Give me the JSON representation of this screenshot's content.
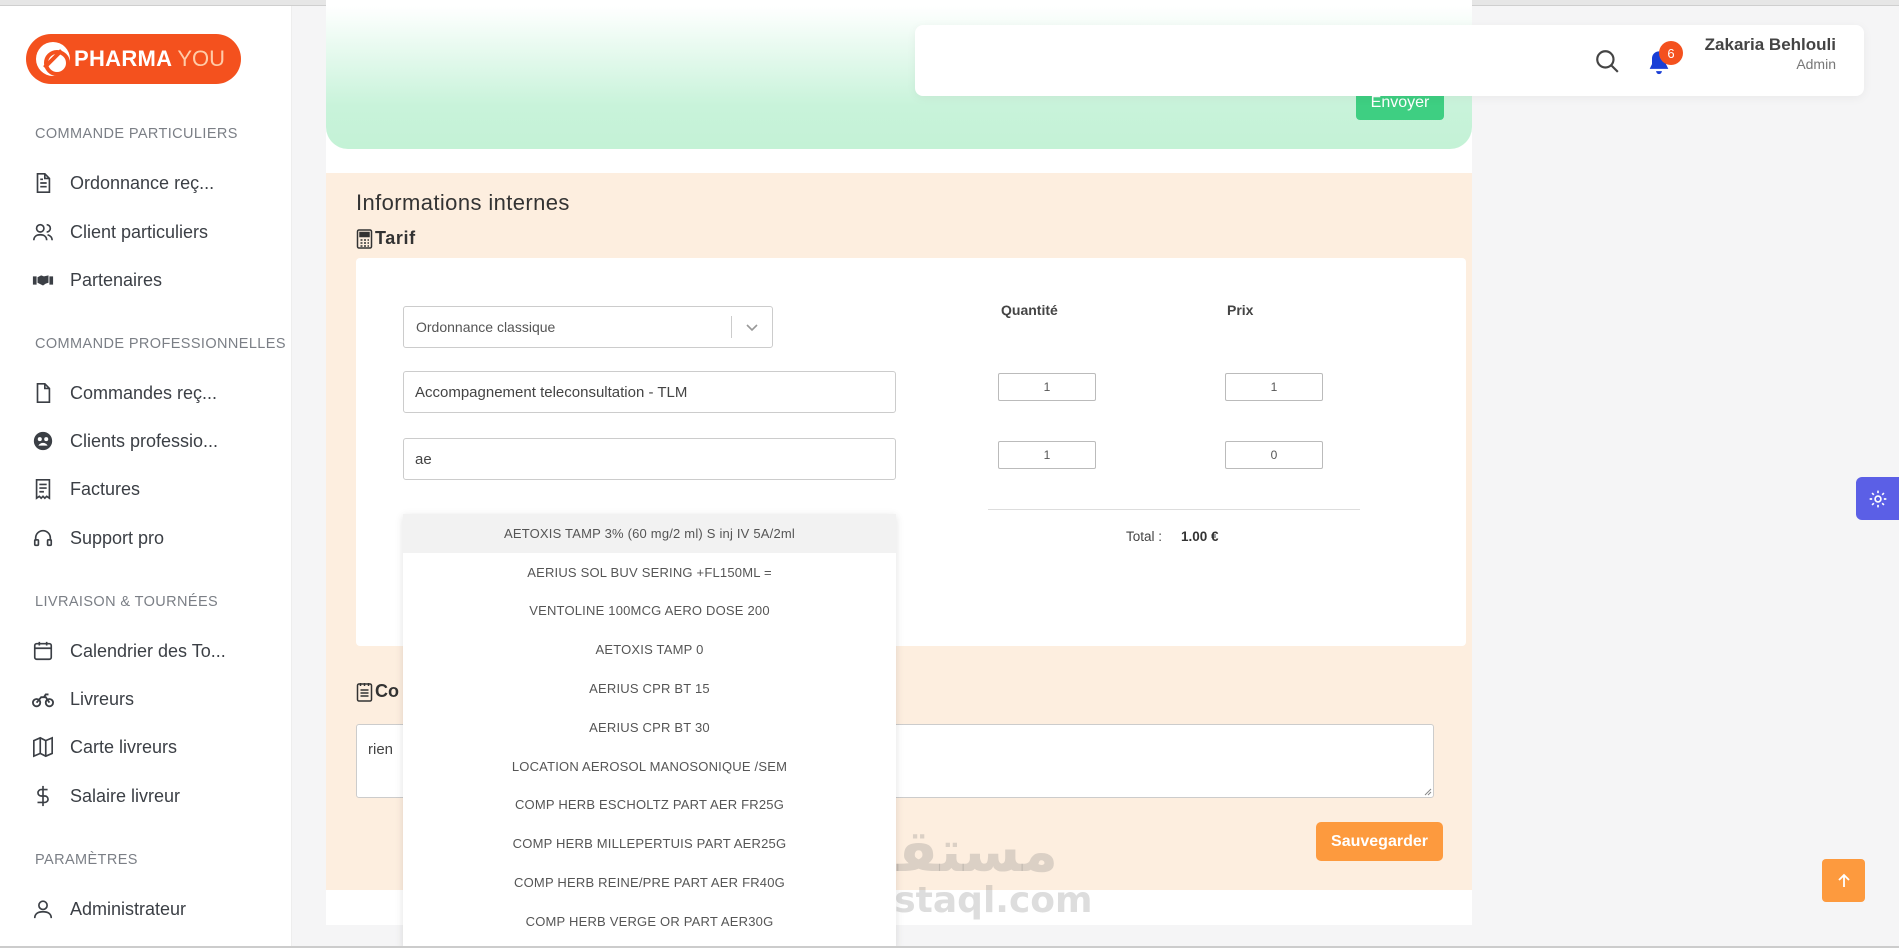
{
  "brand": {
    "name": "PHARMA",
    "accent": "YOU"
  },
  "sidebar": {
    "sections": [
      {
        "title": "COMMANDE PARTICULIERS",
        "items": [
          {
            "label": "Ordonnance reç...",
            "icon": "document-icon"
          },
          {
            "label": "Client particuliers",
            "icon": "users-icon"
          },
          {
            "label": "Partenaires",
            "icon": "handshake-icon"
          }
        ]
      },
      {
        "title": "COMMANDE PROFESSIONNELLES",
        "items": [
          {
            "label": "Commandes reç...",
            "icon": "file-icon"
          },
          {
            "label": "Clients professio...",
            "icon": "user-circle-icon"
          },
          {
            "label": "Factures",
            "icon": "invoice-icon"
          },
          {
            "label": "Support pro",
            "icon": "headset-icon"
          }
        ]
      },
      {
        "title": "LIVRAISON & TOURNÉES",
        "items": [
          {
            "label": "Calendrier des To...",
            "icon": "calendar-icon"
          },
          {
            "label": "Livreurs",
            "icon": "motorcycle-icon"
          },
          {
            "label": "Carte livreurs",
            "icon": "map-icon"
          },
          {
            "label": "Salaire livreur",
            "icon": "dollar-icon"
          }
        ]
      },
      {
        "title": "PARAMÈTRES",
        "items": [
          {
            "label": "Administrateur",
            "icon": "user-icon"
          }
        ]
      }
    ]
  },
  "top_section": {
    "send_label": "Envoyer"
  },
  "header": {
    "notifications_count": "6",
    "user_name": "Zakaria Behlouli",
    "user_role": "Admin"
  },
  "main": {
    "section_title": "Informations internes",
    "tarif_title": "Tarif",
    "tarif_type": "Ordonnance classique",
    "col_quantity": "Quantité",
    "col_price": "Prix",
    "rows": [
      {
        "product": "Accompagnement teleconsultation - TLM",
        "quantity": "1",
        "price": "1"
      },
      {
        "product": "ae",
        "quantity": "1",
        "price": "0"
      }
    ],
    "total_label": "Total :",
    "total_value": "1.00 €",
    "comment_title": "Co",
    "comment_text": "rien",
    "save_label": "Sauvegarder"
  },
  "dropdown": {
    "options": [
      "AETOXIS TAMP 3% (60 mg/2 ml) S inj IV 5A/2ml",
      "AERIUS SOL BUV SERING +FL150ML =",
      "VENTOLINE 100MCG AERO DOSE 200",
      "AETOXIS TAMP 0",
      "AERIUS CPR BT 15",
      "AERIUS CPR BT 30",
      "LOCATION AEROSOL MANOSONIQUE /SEM",
      "COMP HERB ESCHOLTZ PART AER FR25G",
      "COMP HERB MILLEPERTUIS PART AER25G",
      "COMP HERB REINE/PRE PART AER FR40G",
      "COMP HERB VERGE OR PART AER30G"
    ]
  },
  "watermark": {
    "arabic": "مستقل",
    "latin": "mostaql.com"
  },
  "colors": {
    "brand": "#f4511e",
    "send": "#3ecf82",
    "save": "#fd9a3e",
    "settings": "#5b5fe6",
    "notification": "#1a3fd6"
  }
}
